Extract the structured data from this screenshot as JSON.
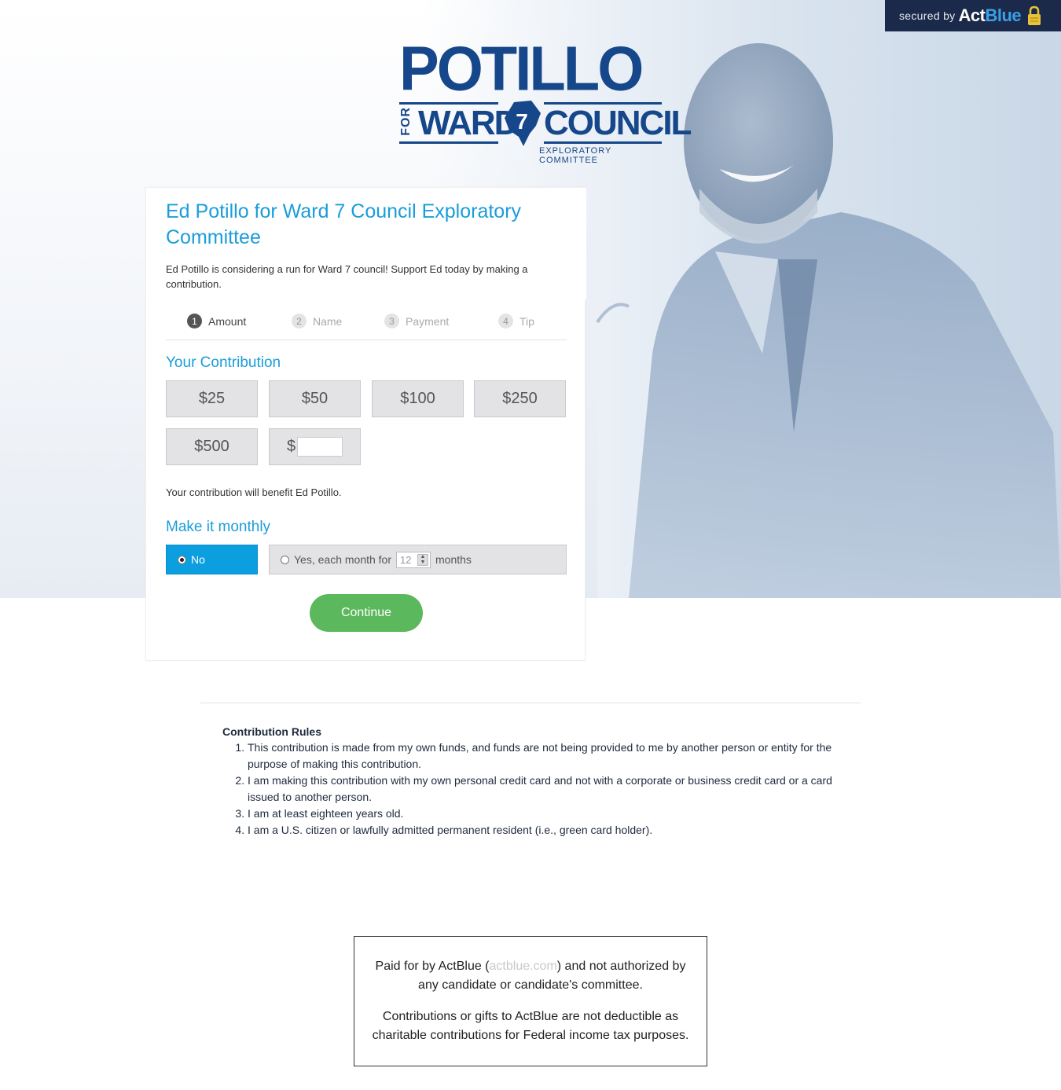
{
  "secured": {
    "prefix": "secured by",
    "brand_act": "Act",
    "brand_blue": "Blue"
  },
  "logo": {
    "name": "POTILLO",
    "for": "FOR",
    "ward": "WARD",
    "number": "7",
    "council": "COUNCIL",
    "subtitle": "EXPLORATORY COMMITTEE"
  },
  "card": {
    "title": "Ed Potillo for Ward 7 Council Exploratory Committee",
    "subtitle": "Ed Potillo is considering a run for Ward 7 council! Support Ed today by making a contribution."
  },
  "steps": [
    {
      "num": "1",
      "label": "Amount"
    },
    {
      "num": "2",
      "label": "Name"
    },
    {
      "num": "3",
      "label": "Payment"
    },
    {
      "num": "4",
      "label": "Tip"
    }
  ],
  "contribution": {
    "title": "Your Contribution",
    "amounts": [
      "$25",
      "$50",
      "$100",
      "$250",
      "$500"
    ],
    "other_prefix": "$",
    "other_value": "",
    "benefit": "Your contribution will benefit Ed Potillo."
  },
  "monthly": {
    "title": "Make it monthly",
    "no_label": "No",
    "yes_prefix": "Yes, each month for",
    "months_value": "12",
    "yes_suffix": "months",
    "selected": "No"
  },
  "continue_label": "Continue",
  "rules": {
    "title": "Contribution Rules",
    "items": [
      "This contribution is made from my own funds, and funds are not being provided to me by another person or entity for the purpose of making this contribution.",
      "I am making this contribution with my own personal credit card and not with a corporate or business credit card or a card issued to another person.",
      "I am at least eighteen years old.",
      "I am a U.S. citizen or lawfully admitted permanent resident (i.e., green card holder)."
    ]
  },
  "footer": {
    "paid_prefix": "Paid for by ActBlue (",
    "paid_link": "actblue.com",
    "paid_suffix": ") and not authorized by any candidate or candidate's committee.",
    "tax_note": "Contributions or gifts to ActBlue are not deductible as charitable contributions for Federal income tax purposes."
  },
  "colors": {
    "accent": "#1a9dd9",
    "selected": "#0c9fe0",
    "continue": "#5cb85c",
    "logo": "#16478a",
    "secured_bg": "#1b2a4a"
  }
}
